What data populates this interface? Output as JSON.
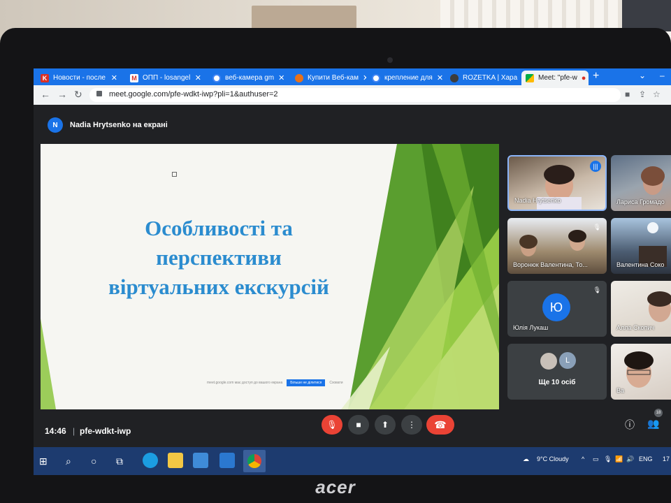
{
  "browser": {
    "tabs": [
      {
        "title": "Новости - после",
        "icon": "kommersant-icon"
      },
      {
        "title": "ОПП - losangel",
        "icon": "gmail-icon"
      },
      {
        "title": "веб-камера gm",
        "icon": "google-icon"
      },
      {
        "title": "Купити Веб-кам",
        "icon": "store-icon"
      },
      {
        "title": "крепление для",
        "icon": "google-icon"
      },
      {
        "title": "ROZETKA | Хара",
        "icon": "rozetka-icon"
      },
      {
        "title": "Meet: \"pfe-w",
        "icon": "meet-icon"
      }
    ],
    "new_tab": "+",
    "url": "meet.google.com/pfe-wdkt-iwp?pli=1&authuser=2"
  },
  "meet": {
    "presenter_initial": "N",
    "presenter_label": "Nadia Hrytsenko на екрані",
    "slide": {
      "title_lines": [
        "Особливості та",
        "перспективи",
        "віртуальних екскурсій"
      ],
      "share_bar_text": "meet.google.com має доступ до вашого екрана",
      "share_button": "Більше не ділитися",
      "hide_text": "Сховати"
    },
    "participants": [
      {
        "name": "Nadia Hrytsenko",
        "selected": true
      },
      {
        "name": "Лариса Громадо"
      },
      {
        "name": "Воронюк Валентина, То..."
      },
      {
        "name": "Валентина Соко"
      },
      {
        "name": "Юлія Лукаш",
        "initial": "Ю"
      },
      {
        "name": "Алла Скопич"
      },
      {
        "name": "Ще 10 осіб",
        "initial2": "L"
      },
      {
        "name": "Ва"
      }
    ],
    "time": "14:46",
    "separator": "|",
    "meeting_code": "pfe-wdkt-iwp",
    "participants_badge": "18"
  },
  "taskbar": {
    "weather": "9°C  Cloudy",
    "language": "ENG",
    "clock_fragment": "17"
  },
  "laptop_brand": "acer",
  "colors": {
    "tab_strip": "#1a73e8",
    "slide_title": "#2b8ccf",
    "end_call": "#ea4335",
    "taskbar": "#1d3b6f"
  }
}
